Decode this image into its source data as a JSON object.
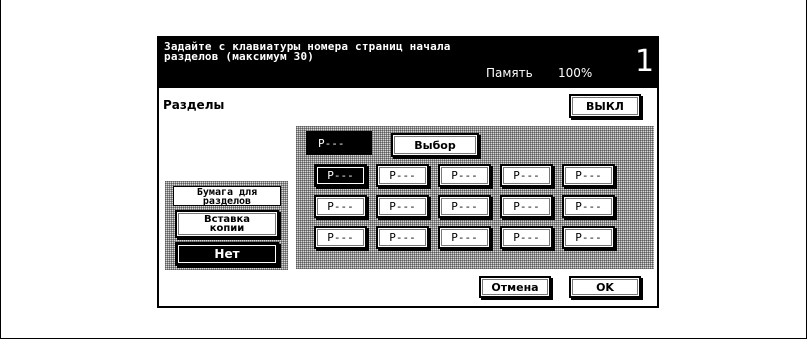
{
  "header": {
    "message": "Задайте с клавиатуры номера страниц начала\nразделов (максимум 30)",
    "memory_label": "Память",
    "memory_value": "100%",
    "page_number": "1"
  },
  "title": "Разделы",
  "off_button": "ВЫКЛ",
  "current_display": "P---",
  "select_button": "Выбор",
  "page_cells": [
    "P---",
    "P---",
    "P---",
    "P---",
    "P---",
    "P---",
    "P---",
    "P---",
    "P---",
    "P---",
    "P---",
    "P---",
    "P---",
    "P---",
    "P---"
  ],
  "selected_cell_index": 0,
  "side": {
    "label": "Бумага для\nразделов",
    "insert_copy_button": "Вставка\nкопии",
    "none_button": "Нет"
  },
  "footer": {
    "cancel_button": "Отмена",
    "ok_button": "OK"
  }
}
